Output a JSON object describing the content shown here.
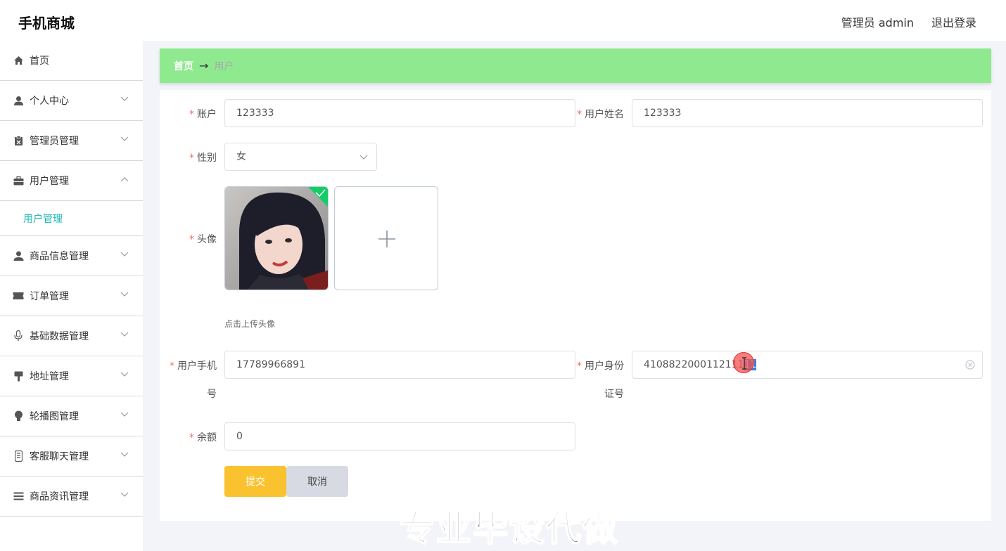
{
  "header": {
    "brand": "手机商城",
    "admin_label": "管理员 admin",
    "logout_label": "退出登录"
  },
  "sidebar": {
    "items": [
      {
        "label": "首页",
        "icon": "home-icon"
      },
      {
        "label": "个人中心",
        "icon": "user-icon"
      },
      {
        "label": "管理员管理",
        "icon": "clipboard-icon"
      },
      {
        "label": "用户管理",
        "icon": "briefcase-icon",
        "expanded": true
      },
      {
        "label": "商品信息管理",
        "icon": "person-icon"
      },
      {
        "label": "订单管理",
        "icon": "ticket-icon"
      },
      {
        "label": "基础数据管理",
        "icon": "microphone-icon"
      },
      {
        "label": "地址管理",
        "icon": "brush-icon"
      },
      {
        "label": "轮播图管理",
        "icon": "bulb-icon"
      },
      {
        "label": "客服聊天管理",
        "icon": "phone-icon"
      },
      {
        "label": "商品资讯管理",
        "icon": "list-icon"
      }
    ],
    "sub_item": "用户管理",
    "active_color": "#19b8b0"
  },
  "breadcrumb": {
    "home": "首页",
    "arrow": "→",
    "current": "用户"
  },
  "form": {
    "account_label": "账户",
    "account_value": "123333",
    "name_label": "用户姓名",
    "name_value": "123333",
    "gender_label": "性别",
    "gender_value": "女",
    "avatar_label": "头像",
    "avatar_hint": "点击上传头像",
    "phone_label_1": "用户手机",
    "phone_label_2": "号",
    "phone_value": "17789966891",
    "idcard_label_1": "用户身份",
    "idcard_label_2": "证号",
    "idcard_value": "4108822000112111",
    "idcard_selected": "11",
    "balance_label": "余额",
    "balance_value": "0",
    "required_mark": "*"
  },
  "buttons": {
    "submit": "提交",
    "cancel": "取消"
  },
  "colors": {
    "breadcrumb_bg": "#8fea8f",
    "submit_bg": "#f9c22e",
    "cancel_bg": "#d8dae3",
    "required": "#f56c6c"
  },
  "watermark": "专业毕设代做"
}
